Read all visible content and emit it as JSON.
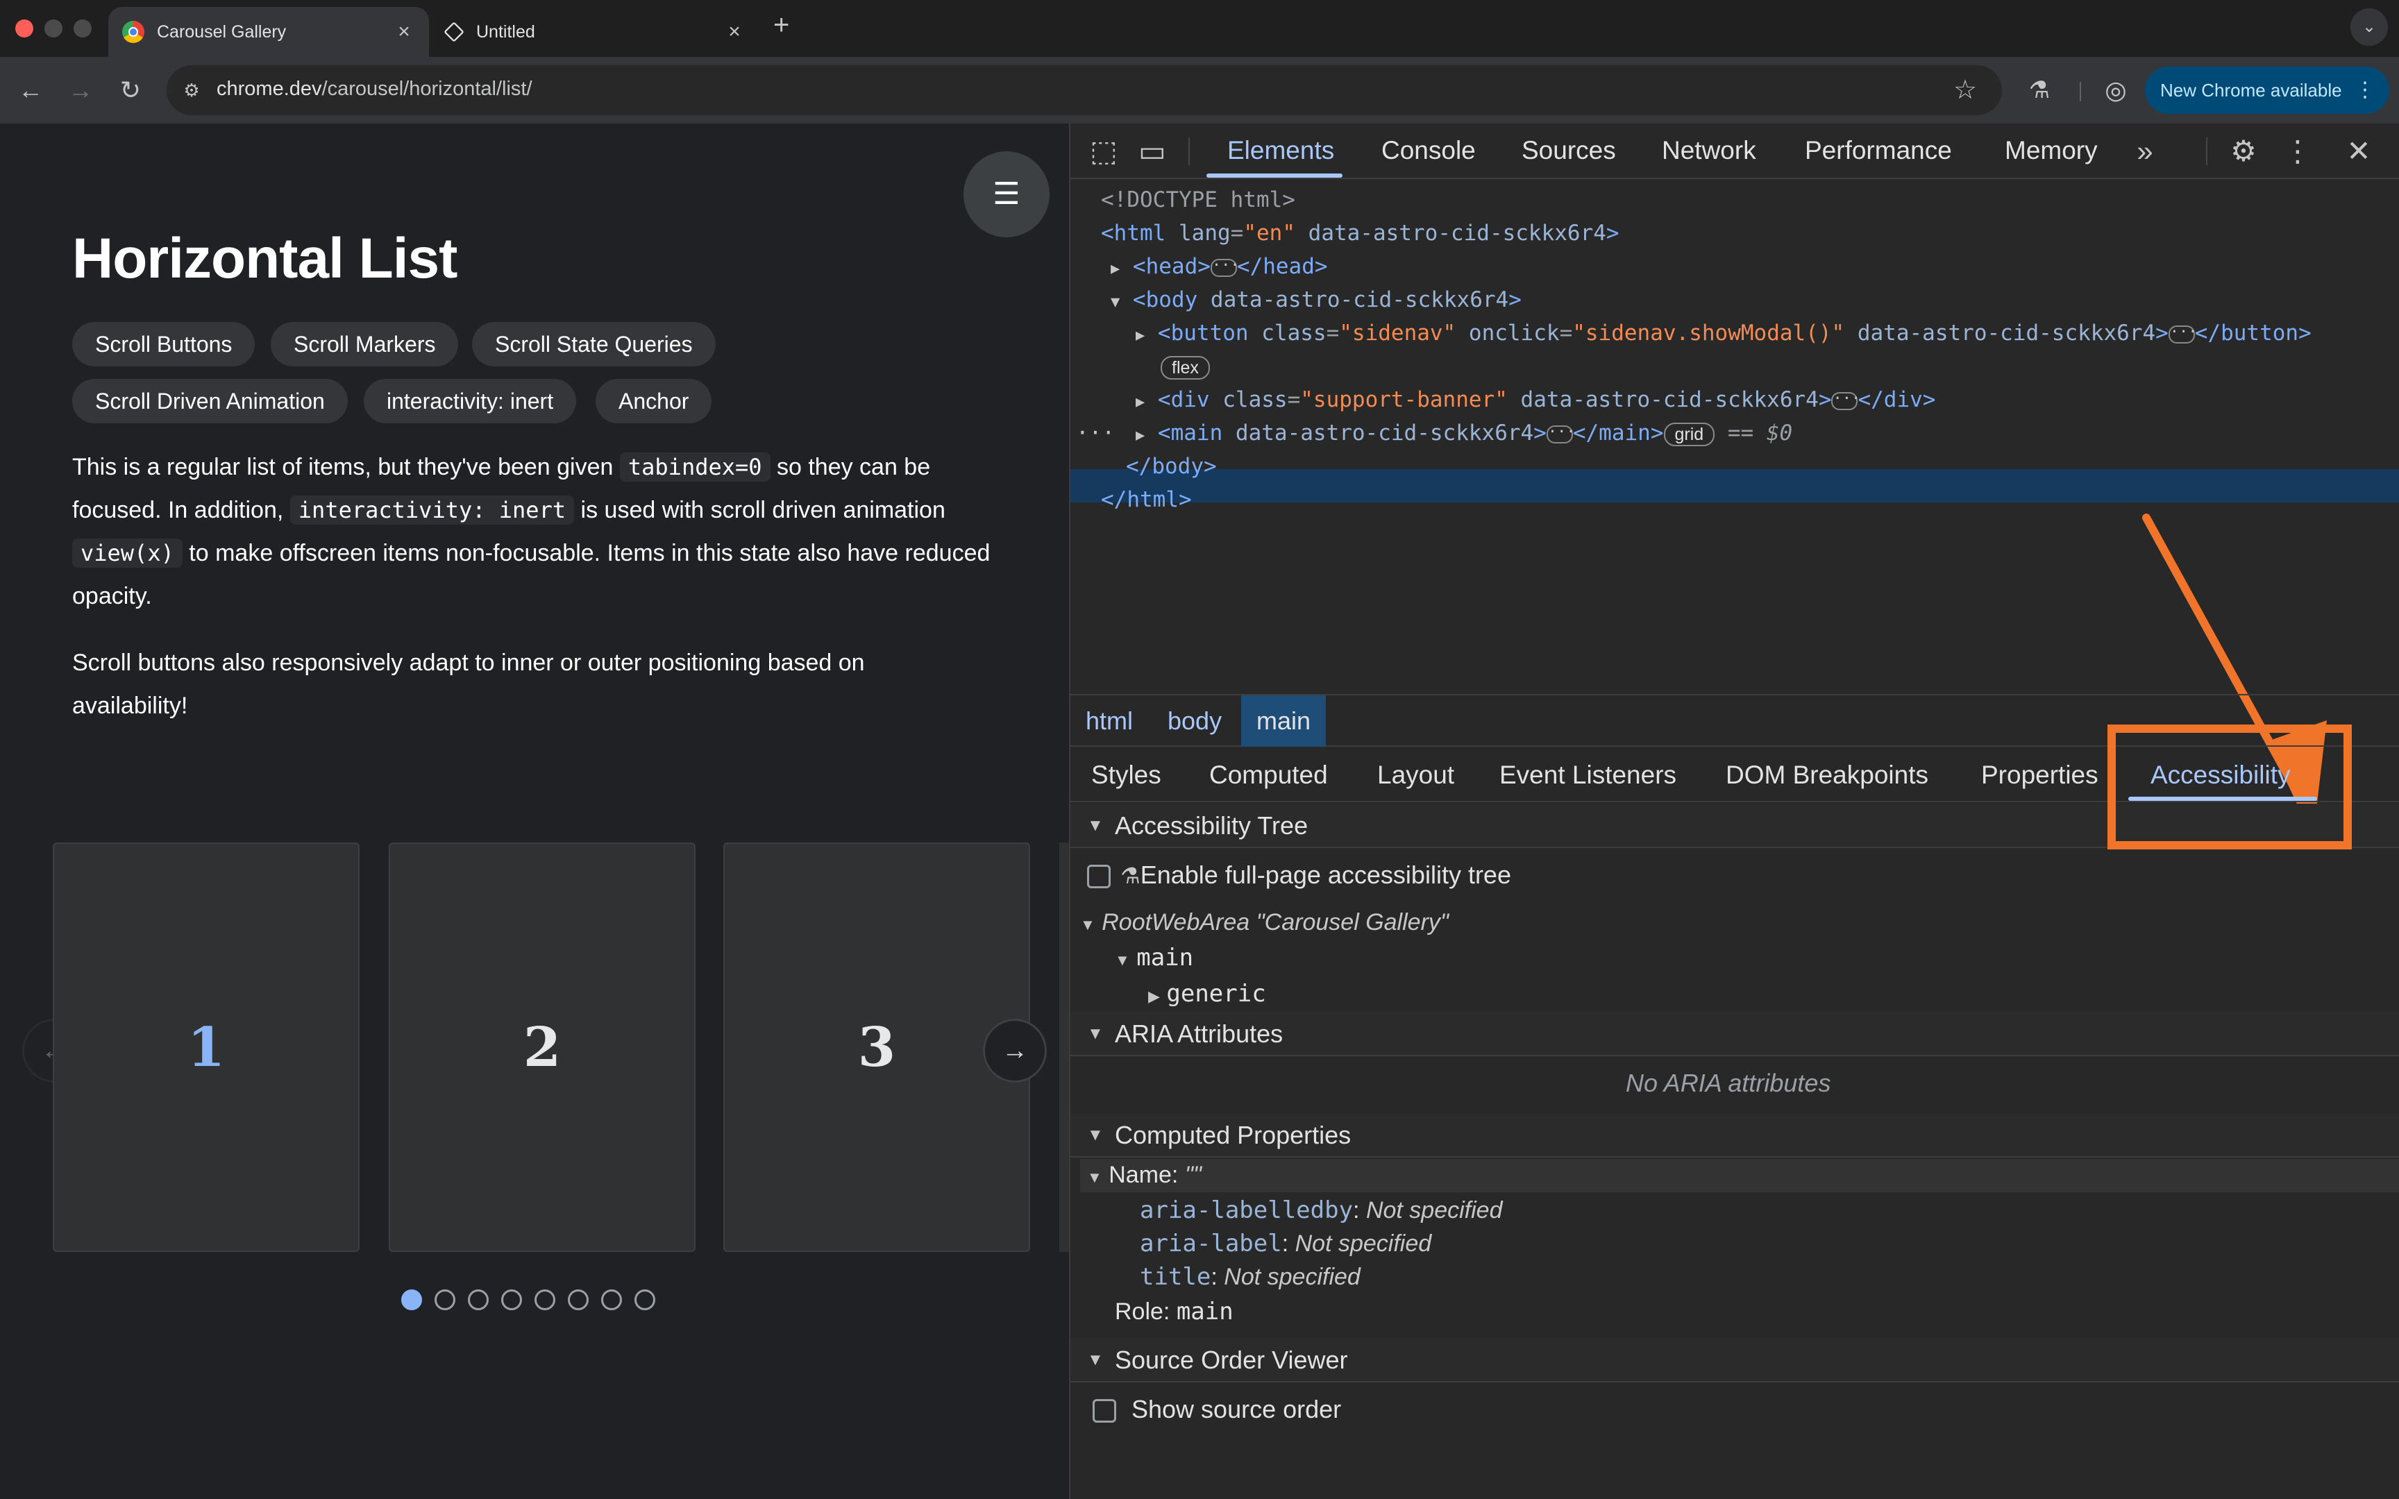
{
  "browser": {
    "tabs": [
      {
        "title": "Carousel Gallery",
        "active": true
      },
      {
        "title": "Untitled",
        "active": false
      }
    ],
    "new_tab": "+",
    "url_host": "chrome.dev",
    "url_path": "/carousel/horizontal/list/",
    "new_chrome": "New Chrome available"
  },
  "page": {
    "title": "Horizontal List",
    "chips": [
      "Scroll Buttons",
      "Scroll Markers",
      "Scroll State Queries",
      "Scroll Driven Animation",
      "interactivity: inert",
      "Anchor"
    ],
    "p1_a": "This is a regular list of items, but they've been given ",
    "p1_code1": "tabindex=0",
    "p1_b": " so they can be focused. In addition, ",
    "p1_code2": "interactivity: inert",
    "p1_c": " is used with scroll driven animation ",
    "p1_code3": "view(x)",
    "p1_d": " to make offscreen items non-focusable. Items in this state also have reduced opacity.",
    "p2": "Scroll buttons also responsively adapt to inner or outer positioning based on availability!",
    "cards": [
      "1",
      "2",
      "3"
    ],
    "markers_count": 8,
    "active_marker": 0
  },
  "devtools": {
    "tabs": [
      "Elements",
      "Console",
      "Sources",
      "Network",
      "Performance",
      "Memory"
    ],
    "selected_tab": "Elements",
    "dom": {
      "doctype": "<!DOCTYPE html>",
      "html_open_tag": "<html",
      "html_attr1_name": "lang",
      "html_attr1_val": "\"en\"",
      "html_attr2": "data-astro-cid-sckkx6r4",
      "head_open": "<head>",
      "head_close": "</head>",
      "body_open": "<body",
      "body_attr": "data-astro-cid-sckkx6r4",
      "button_open": "<button",
      "button_class_name": "class",
      "button_class_val": "\"sidenav\"",
      "button_onclick_name": "onclick",
      "button_onclick_val": "\"sidenav.showModal()\"",
      "button_attr": "data-astro-cid-sckkx6r4",
      "button_close": "</button>",
      "flex_badge": "flex",
      "div_open": "<div",
      "div_class_name": "class",
      "div_class_val": "\"support-banner\"",
      "div_attr": "data-astro-cid-sckkx6r4",
      "div_close": "</div>",
      "main_open": "<main",
      "main_attr": "data-astro-cid-sckkx6r4",
      "main_close": "</main>",
      "grid_badge": "grid",
      "selected_marker": "== $0",
      "body_close": "</body>",
      "html_close": "</html>",
      "gt": ">"
    },
    "breadcrumbs": [
      "html",
      "body",
      "main"
    ],
    "subtabs": [
      "Styles",
      "Computed",
      "Layout",
      "Event Listeners",
      "DOM Breakpoints",
      "Properties",
      "Accessibility"
    ],
    "selected_subtab": "Accessibility",
    "a11y": {
      "tree_header": "Accessibility Tree",
      "enable_full": "Enable full-page accessibility tree",
      "root": "RootWebArea \"Carousel Gallery\"",
      "main_node": "main",
      "generic_node": "generic",
      "aria_header": "ARIA Attributes",
      "no_aria": "No ARIA attributes",
      "computed_header": "Computed Properties",
      "name_label": "Name: ",
      "name_value": "\"\"",
      "labelledby_key": "aria-labelledby",
      "labelledby_val": "Not specified",
      "label_key": "aria-label",
      "label_val": "Not specified",
      "title_key": "title",
      "title_val": "Not specified",
      "role_label": "Role: ",
      "role_value": "main",
      "source_header": "Source Order Viewer",
      "show_source": "Show source order"
    }
  },
  "colors": {
    "accent": "#a8c7fa",
    "annotation": "#f0742a",
    "marker_active": "#8ab4f8"
  },
  "icons": [
    "chrome-logo-icon",
    "codepen-icon",
    "back-arrow-icon",
    "forward-arrow-icon",
    "reload-icon",
    "site-info-icon",
    "star-icon",
    "labs-flask-icon",
    "profile-icon",
    "more-vert-icon",
    "inspect-icon",
    "device-toggle-icon",
    "more-tabs-icon",
    "settings-gear-icon",
    "close-icon",
    "hamburger-menu-icon",
    "arrow-right-icon",
    "arrow-left-icon",
    "flask-icon"
  ]
}
